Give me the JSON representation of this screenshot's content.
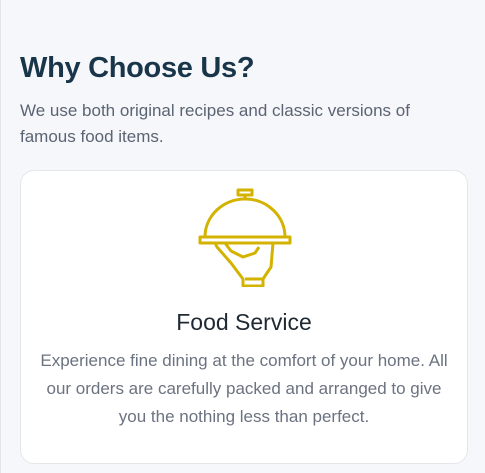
{
  "section": {
    "title": "Why Choose Us?",
    "subtitle": "We use both original recipes and classic versions of famous food items."
  },
  "card": {
    "icon": "serving-cloche-icon",
    "title": "Food Service",
    "description": "Experience fine dining at the comfort of your home. All our orders are carefully packed and arranged to give you the nothing less than perfect.",
    "accent": "#d4b200"
  }
}
